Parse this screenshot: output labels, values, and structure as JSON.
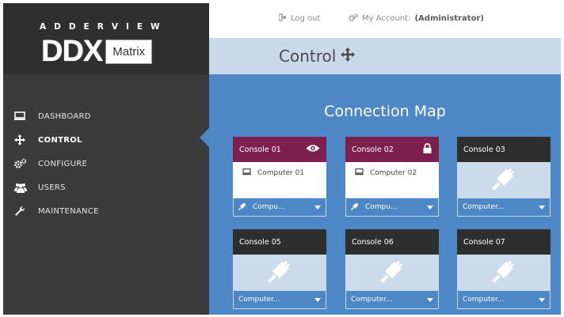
{
  "brand": {
    "wordmark": "ADDERVIEW",
    "logo_main": "DDX",
    "logo_sub": "Matrix"
  },
  "header": {
    "logout": "Log out",
    "account_label": "My Account:",
    "account_user": "(Administrator)"
  },
  "page": {
    "title": "Control"
  },
  "sidebar": {
    "items": [
      {
        "label": "DASHBOARD",
        "icon": "monitor-icon"
      },
      {
        "label": "CONTROL",
        "icon": "move-icon",
        "active": true
      },
      {
        "label": "CONFIGURE",
        "icon": "gears-icon"
      },
      {
        "label": "USERS",
        "icon": "users-icon"
      },
      {
        "label": "MAINTENANCE",
        "icon": "wrench-icon"
      }
    ]
  },
  "map": {
    "title": "Connection Map",
    "consoles": [
      {
        "name": "Console 01",
        "status_icon": "eye-icon",
        "computer": "Computer 01",
        "select": "Compu..."
      },
      {
        "name": "Console 02",
        "status_icon": "lock-icon",
        "computer": "Computer 02",
        "select": "Compu..."
      },
      {
        "name": "Console 03",
        "select": "Computer..."
      },
      {
        "name": "Console 05",
        "select": "Computer..."
      },
      {
        "name": "Console 06",
        "select": "Computer..."
      },
      {
        "name": "Console 07",
        "select": "Computer..."
      }
    ]
  },
  "colors": {
    "sidebar": "#3b3b3b",
    "accent_blue": "#4d87c5",
    "maroon": "#7d1f4f",
    "subheader": "#c9d9ea"
  }
}
